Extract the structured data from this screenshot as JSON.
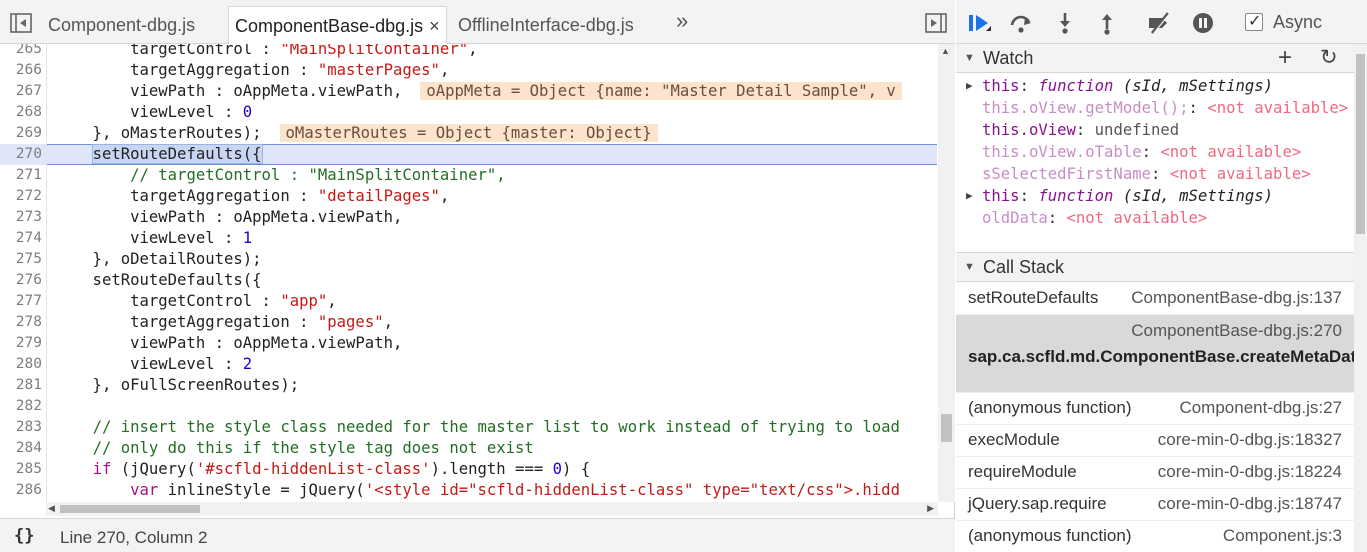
{
  "tabs": [
    {
      "label": "Component-dbg.js",
      "active": false
    },
    {
      "label": "ComponentBase-dbg.js",
      "active": true,
      "close": "×"
    },
    {
      "label": "OfflineInterface-dbg.js",
      "active": false
    }
  ],
  "tabs_more": "»",
  "code_lines": [
    {
      "n": "265",
      "html": "        targetControl : <span class=\"str\">\"MainSplitContainer\"</span>,"
    },
    {
      "n": "266",
      "html": "        targetAggregation : <span class=\"str\">\"masterPages\"</span>,"
    },
    {
      "n": "267",
      "html": "        viewPath : oAppMeta.viewPath,<span class=\"inline-val\">oAppMeta = Object {name: \"Master Detail Sample\", v</span>"
    },
    {
      "n": "268",
      "html": "        viewLevel : <span class=\"num\">0</span>"
    },
    {
      "n": "269",
      "html": "    }, oMasterRoutes);<span class=\"inline-val\">oMasterRoutes = Object {master: Object}</span>"
    },
    {
      "n": "270",
      "html": "    <span class=\"sel\">setRouteDefaults({</span>",
      "current": true
    },
    {
      "n": "271",
      "html": "        <span class=\"cmt\">// targetControl : \"MainSplitContainer\",</span>"
    },
    {
      "n": "272",
      "html": "        targetAggregation : <span class=\"str\">\"detailPages\"</span>,"
    },
    {
      "n": "273",
      "html": "        viewPath : oAppMeta.viewPath,"
    },
    {
      "n": "274",
      "html": "        viewLevel : <span class=\"num\">1</span>"
    },
    {
      "n": "275",
      "html": "    }, oDetailRoutes);"
    },
    {
      "n": "276",
      "html": "    setRouteDefaults({"
    },
    {
      "n": "277",
      "html": "        targetControl : <span class=\"str\">\"app\"</span>,"
    },
    {
      "n": "278",
      "html": "        targetAggregation : <span class=\"str\">\"pages\"</span>,"
    },
    {
      "n": "279",
      "html": "        viewPath : oAppMeta.viewPath,"
    },
    {
      "n": "280",
      "html": "        viewLevel : <span class=\"num\">2</span>"
    },
    {
      "n": "281",
      "html": "    }, oFullScreenRoutes);"
    },
    {
      "n": "282",
      "html": ""
    },
    {
      "n": "283",
      "html": "    <span class=\"cmt\">// insert the style class needed for the master list to work instead of trying to load</span>"
    },
    {
      "n": "284",
      "html": "    <span class=\"cmt\">// only do this if the style tag does not exist</span>"
    },
    {
      "n": "285",
      "html": "    <span class=\"kw\">if</span> (jQuery(<span class=\"str\">'#scfld-hiddenList-class'</span>).length === <span class=\"num\">0</span>) {"
    },
    {
      "n": "286",
      "html": "        <span class=\"kw\">var</span> inlineStyle = jQuery(<span class=\"str\">'&lt;style id=\"scfld-hiddenList-class\" type=\"text/css\"&gt;.hidd</span>"
    },
    {
      "n": "287",
      "html": ""
    }
  ],
  "status": {
    "pretty_print": "{}",
    "cursor": "Line 270, Column 2"
  },
  "debugger": {
    "async_label": "Async",
    "async_checked": true
  },
  "watch": {
    "title": "Watch",
    "add": "+",
    "refresh": "↻",
    "rows": [
      {
        "expandable": true,
        "name": "this",
        "sep": ": ",
        "fn": "function",
        "args": " (sId, mSettings)"
      },
      {
        "expandable": false,
        "name": "this.oView.getModel();",
        "dim": true,
        "sep": ": ",
        "na": "<not available>"
      },
      {
        "expandable": false,
        "name": "this.oView",
        "sep": ": ",
        "val": "undefined"
      },
      {
        "expandable": false,
        "name": "this.oView.oTable",
        "dim": true,
        "sep": ": ",
        "na": "<not available>"
      },
      {
        "expandable": false,
        "name": "sSelectedFirstName",
        "dim": true,
        "sep": ": ",
        "na": "<not available>"
      },
      {
        "expandable": true,
        "name": "this",
        "sep": ": ",
        "fn": "function",
        "args": " (sId, mSettings)"
      },
      {
        "expandable": false,
        "name": "oldData",
        "dim": true,
        "sep": ": ",
        "na": "<not available>"
      }
    ]
  },
  "callstack": {
    "title": "Call Stack",
    "frames": [
      {
        "fn": "setRouteDefaults",
        "loc": "ComponentBase-dbg.js:137",
        "selected": false
      },
      {
        "fn": "sap.ca.scfld.md.ComponentBase.createMetaData",
        "loc": "ComponentBase-dbg.js:270",
        "selected": true
      },
      {
        "fn": "(anonymous function)",
        "loc": "Component-dbg.js:27",
        "selected": false
      },
      {
        "fn": "execModule",
        "loc": "core-min-0-dbg.js:18327",
        "selected": false
      },
      {
        "fn": "requireModule",
        "loc": "core-min-0-dbg.js:18224",
        "selected": false
      },
      {
        "fn": "jQuery.sap.require",
        "loc": "core-min-0-dbg.js:18747",
        "selected": false
      },
      {
        "fn": "(anonymous function)",
        "loc": "Component.js:3",
        "selected": false
      }
    ]
  },
  "colors": {
    "accent": "#1a73e8",
    "current_line": "#dfe6f7",
    "inline_value_bg": "#fbe3cc"
  },
  "icons": [
    "toggle-navigator-icon",
    "toggle-debugger-sidebar-icon",
    "resume-icon",
    "step-over-icon",
    "step-into-icon",
    "step-out-icon",
    "deactivate-breakpoints-icon",
    "pause-on-exceptions-icon"
  ]
}
